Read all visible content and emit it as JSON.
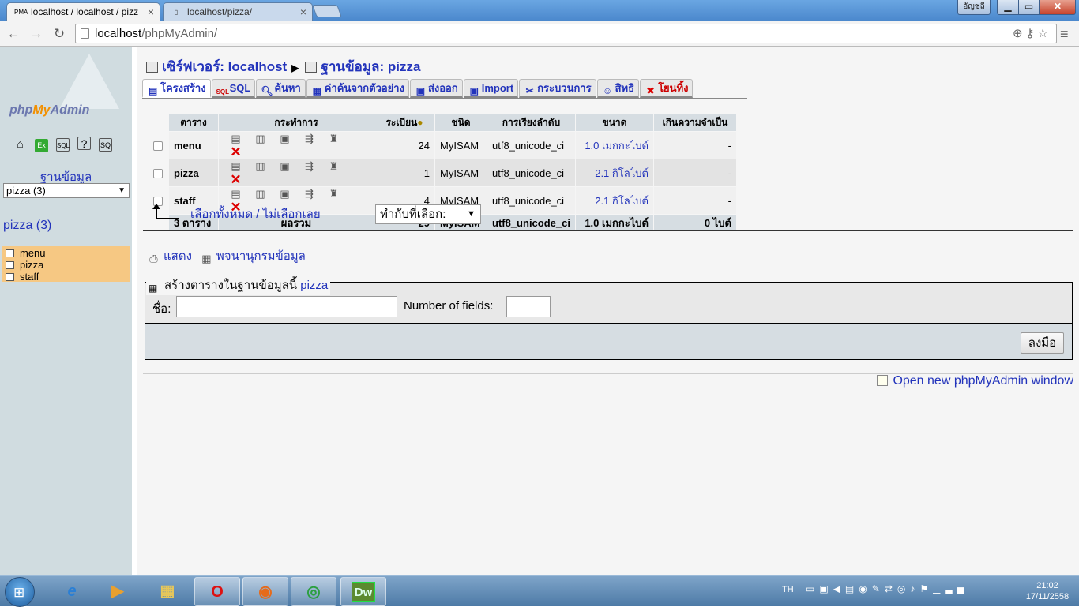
{
  "browser": {
    "tabs": [
      {
        "title": "localhost / localhost / pizz",
        "favicon": "PMA"
      },
      {
        "title": "localhost/pizza/",
        "favicon": ""
      }
    ],
    "user_badge": "อัญชลี",
    "url_host": "localhost",
    "url_path": "/phpMyAdmin/"
  },
  "sidebar": {
    "logo_php": "php",
    "logo_my": "My",
    "logo_admin": "Admin",
    "db_label": "ฐานข้อมูล",
    "db_select_value": "pizza (3)",
    "db_name": "pizza (3)",
    "tables": [
      "menu",
      "pizza",
      "staff"
    ]
  },
  "main": {
    "breadcrumb": {
      "server": "เซิร์ฟเวอร์: localhost",
      "database": "ฐานข้อมูล: pizza"
    },
    "tabs": [
      {
        "label": "โครงสร้าง",
        "icon": "structure-icon"
      },
      {
        "label": "SQL",
        "icon": "sql-icon"
      },
      {
        "label": "ค้นหา",
        "icon": "search-icon"
      },
      {
        "label": "ค่าค้นจากตัวอย่าง",
        "icon": "query-icon"
      },
      {
        "label": "ส่งออก",
        "icon": "export-icon"
      },
      {
        "label": "Import",
        "icon": "import-icon"
      },
      {
        "label": "กระบวนการ",
        "icon": "operations-icon"
      },
      {
        "label": "สิทธิ",
        "icon": "privileges-icon"
      },
      {
        "label": "โยนทิ้ง",
        "icon": "drop-icon"
      }
    ],
    "table": {
      "headers": {
        "table": "ตาราง",
        "action": "กระทำการ",
        "rows": "ระเบียน",
        "type": "ชนิด",
        "collation": "การเรียงลำดับ",
        "size": "ขนาด",
        "overhead": "เกินความจำเป็น"
      },
      "rows": [
        {
          "name": "menu",
          "rows": "24",
          "type": "MyISAM",
          "collation": "utf8_unicode_ci",
          "size": "1.0 เมกกะไบต์",
          "overhead": "-"
        },
        {
          "name": "pizza",
          "rows": "1",
          "type": "MyISAM",
          "collation": "utf8_unicode_ci",
          "size": "2.1 กิโลไบต์",
          "overhead": "-"
        },
        {
          "name": "staff",
          "rows": "4",
          "type": "MyISAM",
          "collation": "utf8_unicode_ci",
          "size": "2.1 กิโลไบต์",
          "overhead": "-"
        }
      ],
      "footer": {
        "count": "3 ตาราง",
        "sum_label": "ผลรวม",
        "rows": "29",
        "type": "MyISAM",
        "collation": "utf8_unicode_ci",
        "size": "1.0 เมกกะไบต์",
        "overhead": "0 ไบต์"
      }
    },
    "check_all": "เลือกทั้งหมด",
    "check_sep": " / ",
    "uncheck_all": "ไม่เลือกเลย",
    "with_selected": "ทำกับที่เลือก:",
    "links": {
      "print": "แสดง",
      "dictionary": "พจนานุกรมข้อมูล"
    },
    "create": {
      "legend": "สร้างตารางในฐานข้อมูลนี้",
      "db": "pizza",
      "name_label": "ชื่อ:",
      "fields_label": "Number of fields:",
      "go": "ลงมือ"
    },
    "new_window": "Open new phpMyAdmin window"
  },
  "taskbar": {
    "lang": "TH",
    "apps": [
      "ie-icon",
      "media-player-icon",
      "explorer-icon",
      "opera-icon",
      "firefox-icon",
      "chrome-icon",
      "dreamweaver-icon"
    ],
    "dw_label": "Dw",
    "time": "21:02",
    "date": "17/11/2558"
  },
  "colors": {
    "link": "#2233bb",
    "sidebar_bg": "#d0dce0",
    "table_highlight": "#f6c883"
  }
}
